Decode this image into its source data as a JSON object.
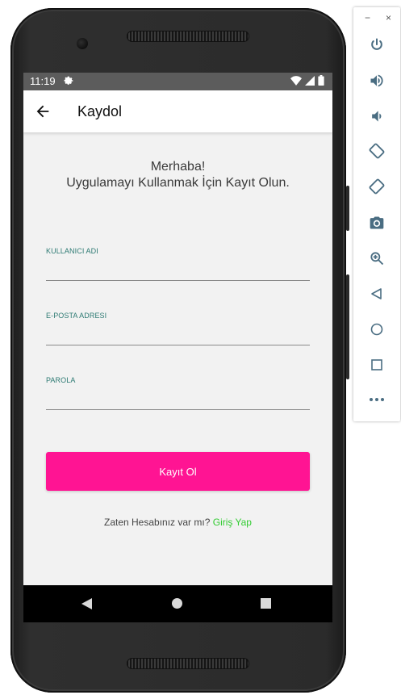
{
  "status_bar": {
    "time": "11:19"
  },
  "app_bar": {
    "title": "Kaydol"
  },
  "welcome": {
    "line1": "Merhaba!",
    "line2": "Uygulamayı Kullanmak İçin Kayıt Olun."
  },
  "form": {
    "username_label": "KULLANICI ADI",
    "email_label": "E-POSTA ADRESI",
    "password_label": "PAROLA",
    "username_value": "",
    "email_value": "",
    "password_value": ""
  },
  "register_button": {
    "label": "Kayıt Ol"
  },
  "login_prompt": {
    "text": "Zaten Hesabınız var mı?",
    "link": "Giriş Yap"
  },
  "emulator_panel": {
    "minimize": "−",
    "close": "×",
    "tools": [
      "power-icon",
      "volume-up-icon",
      "volume-down-icon",
      "rotate-left-icon",
      "rotate-right-icon",
      "camera-icon",
      "zoom-icon",
      "back-icon",
      "home-icon",
      "overview-icon",
      "more-icon"
    ]
  },
  "colors": {
    "accent": "#ff1493",
    "link": "#33cc33",
    "label": "#2d7a73",
    "status_bar": "#5c5c5c",
    "panel_icon": "#4a6d82"
  }
}
